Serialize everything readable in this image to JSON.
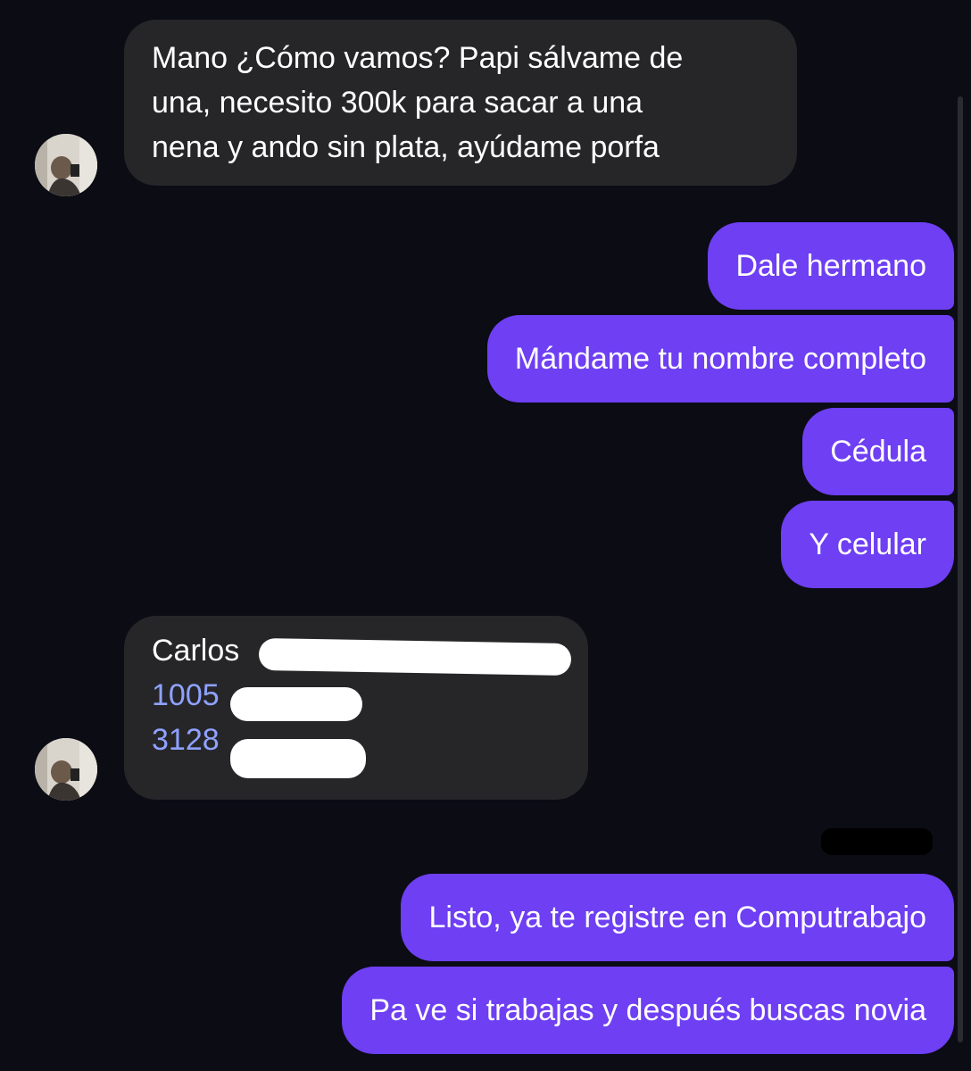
{
  "messages": [
    {
      "direction": "incoming",
      "lines": [
        "Mano ¿Cómo vamos? Papi sálvame de",
        "una, necesito 300k para sacar a una",
        "nena y ando sin plata, ayúdame porfa"
      ]
    },
    {
      "direction": "outgoing",
      "text": "Dale hermano"
    },
    {
      "direction": "outgoing",
      "text": "Mándame tu nombre completo"
    },
    {
      "direction": "outgoing",
      "text": "Cédula"
    },
    {
      "direction": "outgoing",
      "text": "Y celular"
    },
    {
      "direction": "incoming",
      "name_prefix": "Carlos",
      "id_prefix": "1005",
      "phone_prefix": "3128"
    },
    {
      "direction": "outgoing",
      "text": "Listo, ya te registre en Computrabajo"
    },
    {
      "direction": "outgoing",
      "text": "Pa ve si trabajas y después buscas novia"
    }
  ],
  "colors": {
    "background": "#0b0c14",
    "incoming_bubble": "#262629",
    "outgoing_bubble": "#6e3ff3",
    "link": "#8fa2ff"
  }
}
